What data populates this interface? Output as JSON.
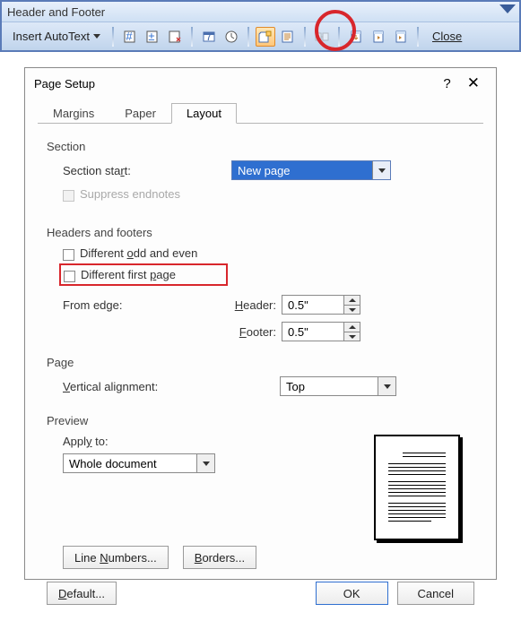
{
  "toolbar": {
    "title": "Header and Footer",
    "autotext_label": "Insert AutoText",
    "close_label": "Close"
  },
  "dialog": {
    "title": "Page Setup",
    "tabs": {
      "margins": "Margins",
      "paper": "Paper",
      "layout": "Layout"
    },
    "section": {
      "label": "Section",
      "start_label": "Section start:",
      "start_value": "New page",
      "suppress_label": "Suppress endnotes"
    },
    "hf": {
      "label": "Headers and footers",
      "odd_even": "Different odd and even",
      "first_page": "Different first page",
      "from_edge": "From edge:",
      "header_label": "Header:",
      "footer_label": "Footer:",
      "header_value": "0.5\"",
      "footer_value": "0.5\""
    },
    "page": {
      "label": "Page",
      "valign_label": "Vertical alignment:",
      "valign_value": "Top"
    },
    "preview": {
      "label": "Preview",
      "apply_label": "Apply to:",
      "apply_value": "Whole document"
    },
    "buttons": {
      "line_numbers": "Line Numbers...",
      "borders": "Borders...",
      "defaults": "Default...",
      "ok": "OK",
      "cancel": "Cancel"
    }
  }
}
